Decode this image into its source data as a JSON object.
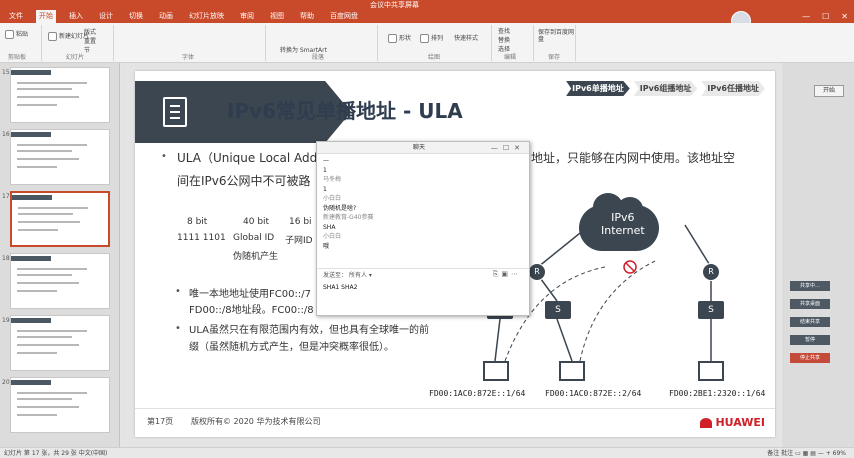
{
  "window": {
    "title": "会议中共享屏幕"
  },
  "ribbon_tabs": [
    "文件",
    "开始",
    "插入",
    "设计",
    "切换",
    "动画",
    "幻灯片放映",
    "审阅",
    "视图",
    "帮助",
    "百度网盘"
  ],
  "ribbon": {
    "paste": "粘贴",
    "new_slide": "新建幻灯片",
    "layout": "版式",
    "reset": "重置",
    "section": "节",
    "shape": "形状",
    "arrange": "排列",
    "quick_styles": "快速样式",
    "find": "查找",
    "replace": "替换",
    "select": "选择",
    "save_baidu": "保存到百度网盘",
    "group_clipboard": "剪贴板",
    "group_slides": "幻灯片",
    "group_font": "字体",
    "group_paragraph": "段落",
    "group_drawing": "绘图",
    "group_editing": "编辑",
    "group_save": "保存",
    "smartart": "转换为 SmartArt"
  },
  "thumbnails": [
    {
      "num": "15",
      "selected": false
    },
    {
      "num": "16",
      "selected": false
    },
    {
      "num": "17",
      "selected": true
    },
    {
      "num": "18",
      "selected": false
    },
    {
      "num": "19",
      "selected": false
    },
    {
      "num": "20",
      "selected": false
    }
  ],
  "slide": {
    "title": "IPv6常见单播地址 - ULA",
    "nav": [
      "IPv6单播地址",
      "IPv6组播地址",
      "IPv6任播地址"
    ],
    "bullet1_line1": "ULA（Unique Local Add",
    "bullet1_line1_right": "地址，只能够在内网中使用。该地址空",
    "bullet1_line2": "间在IPv6公网中不可被路",
    "bits": [
      "8 bit",
      "40 bit",
      "16 bi"
    ],
    "bits_values": [
      "1111 1101",
      "Global ID",
      "子网ID"
    ],
    "pseudo_random": "伪随机产生",
    "sub1": "唯一本地地址使用FC00::/7",
    "sub2": "FD00::/8地址段。FC00::/8",
    "bullet2_line1": "ULA虽然只在有限范围内有效，但也具有全球唯一的前",
    "bullet2_line2": "缀（虽然随机方式产生，但是冲突概率很低）。",
    "cloud": "IPv6\nInternet",
    "router": "R",
    "switch": "S",
    "addresses": [
      "FD00:1AC0:872E::1/64",
      "FD00:1AC0:872E::2/64",
      "FD00:2BE1:2320::1/64"
    ],
    "page": "第17页",
    "copyright": "版权所有© 2020 华为技术有限公司",
    "brand": "HUAWEI"
  },
  "chat": {
    "title": "聊天",
    "messages": [
      {
        "text": "—",
        "dim": false
      },
      {
        "text": "1",
        "dim": false
      },
      {
        "text": "马冬梅",
        "dim": true
      },
      {
        "text": "1",
        "dim": false
      },
      {
        "text": "小白白",
        "dim": true
      },
      {
        "text": "伪随机是啥?",
        "dim": false
      },
      {
        "text": "新建教育-G40参赛",
        "dim": true
      },
      {
        "text": "SHA",
        "dim": false
      },
      {
        "text": "小白白",
        "dim": true
      },
      {
        "text": "哦",
        "dim": false
      }
    ],
    "send_to_label": "发送至：",
    "send_to_value": "所有人 ▾",
    "input_value": "SHA1 SHA2"
  },
  "right_panel": {
    "button": "开始",
    "items": [
      "共享中…",
      "共享桌面",
      "结束共享",
      "暂停",
      "停止共享"
    ]
  },
  "statusbar": {
    "left": "幻灯片 第 17 张，共 29 张   中文(中国)",
    "right": "备注  批注  ▭  ▦  ▤  —  +  69%"
  },
  "colors": {
    "accent": "#c94a2b",
    "title_bar": "#3c4650",
    "huawei_red": "#d01f28"
  }
}
